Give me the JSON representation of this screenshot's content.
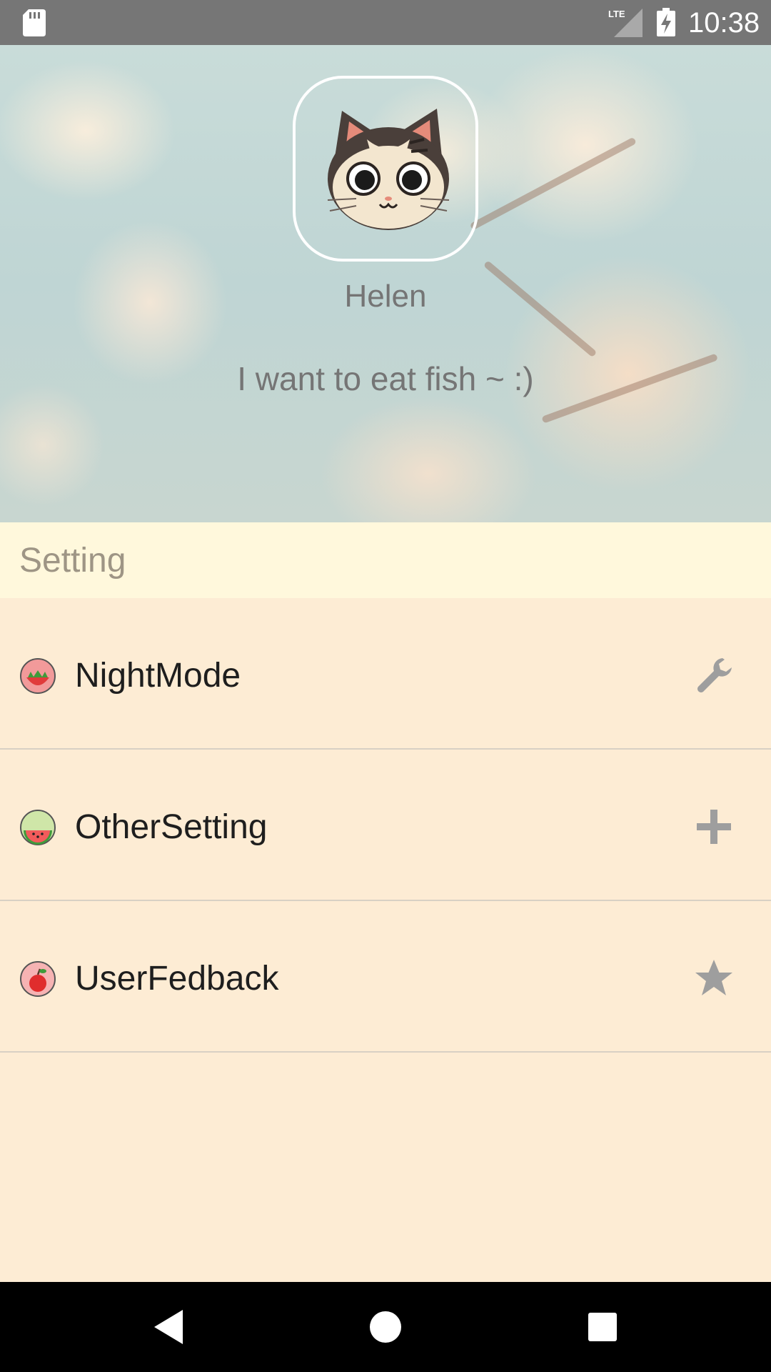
{
  "status_bar": {
    "time": "10:38",
    "network": "LTE",
    "icons": [
      "sd-card-icon",
      "lte-signal-icon",
      "battery-charging-icon"
    ]
  },
  "profile": {
    "name": "Helen",
    "bio": "I want to eat fish ~     :)",
    "avatar_icon": "cat-face-avatar"
  },
  "settings": {
    "title": "Setting",
    "items": [
      {
        "label": "NightMode",
        "icon": "strawberry-icon",
        "action_icon": "wrench-icon"
      },
      {
        "label": "OtherSetting",
        "icon": "watermelon-icon",
        "action_icon": "plus-icon"
      },
      {
        "label": "UserFedback",
        "icon": "apple-icon",
        "action_icon": "star-icon"
      }
    ]
  },
  "nav_bar": {
    "buttons": [
      "back-icon",
      "home-icon",
      "recents-icon"
    ]
  },
  "colors": {
    "status_bar": "#767676",
    "section_header_bg": "#fff8dc",
    "list_bg": "#fdecd4",
    "divider": "#d8d0c4",
    "action_icon": "#9e9e9e"
  }
}
